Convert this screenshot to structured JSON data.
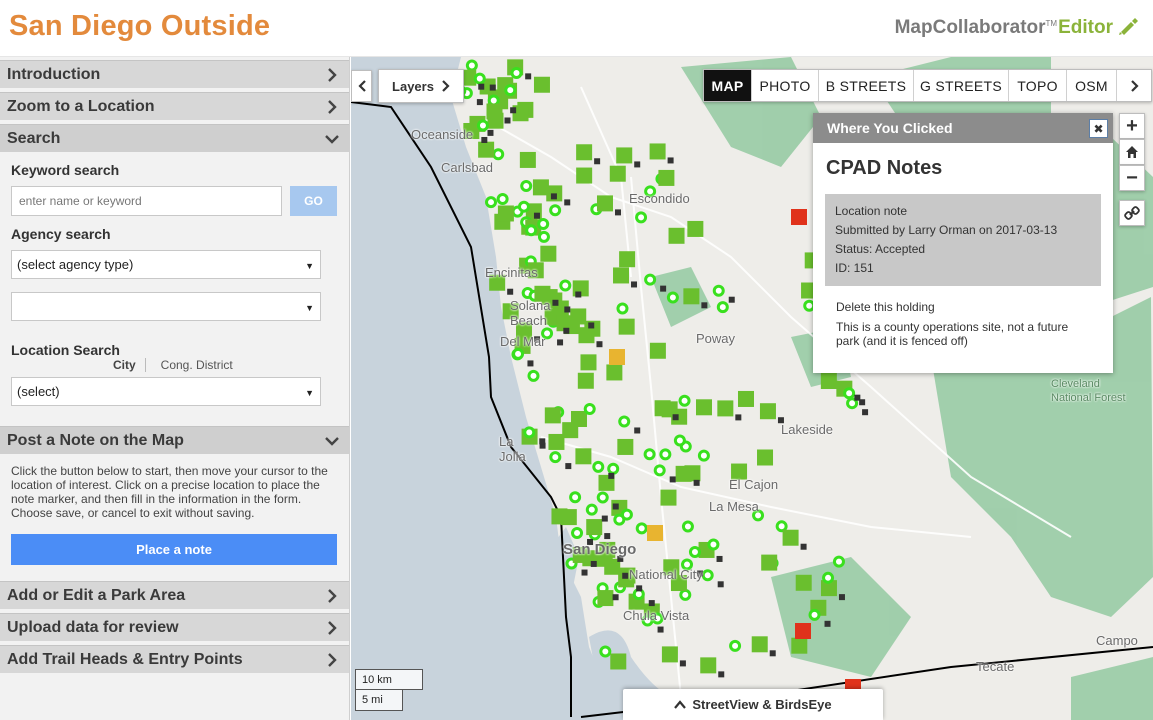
{
  "header": {
    "title": "San Diego Outside",
    "brand_name": "MapCollaborator",
    "brand_tm": "TM",
    "brand_suffix": "Editor"
  },
  "sidebar": {
    "sections": [
      {
        "label": "Introduction",
        "state": "collapsed"
      },
      {
        "label": "Zoom to a Location",
        "state": "collapsed"
      },
      {
        "label": "Search",
        "state": "expanded"
      },
      {
        "label": "Post a Note on the Map",
        "state": "expanded"
      },
      {
        "label": "Add or Edit a Park Area",
        "state": "collapsed"
      },
      {
        "label": "Upload data for review",
        "state": "collapsed"
      },
      {
        "label": "Add Trail Heads & Entry Points",
        "state": "collapsed"
      }
    ],
    "search": {
      "keyword_label": "Keyword search",
      "keyword_placeholder": "enter name or keyword",
      "go_label": "GO",
      "agency_label": "Agency search",
      "agency_selected": "(select agency type)",
      "agency_second_selected": "",
      "location_label": "Location Search",
      "location_toggle": [
        "City",
        "Cong. District"
      ],
      "location_selected": "(select)"
    },
    "post_note": {
      "instructions": "Click the button below to start, then move your cursor to the location of interest. Click on a precise location to place the note marker, and then fill in the information in the form. Choose save, or cancel to exit without saving.",
      "button_label": "Place a note"
    }
  },
  "map": {
    "layers_label": "Layers",
    "basemaps": [
      "MAP",
      "PHOTO",
      "B STREETS",
      "G STREETS",
      "TOPO",
      "OSM"
    ],
    "active_basemap": "MAP",
    "zoom_in": "+",
    "zoom_out": "−",
    "places": [
      "Oceanside",
      "Carlsbad",
      "Escondido",
      "Encinitas",
      "Solana Beach",
      "Del Mar",
      "Poway",
      "La Jolla",
      "Lakeside",
      "El Cajon",
      "La Mesa",
      "San Diego",
      "National City",
      "Chula Vista",
      "Tecate",
      "Campo",
      "Cleveland National Forest"
    ],
    "scale_km": "10 km",
    "scale_mi": "5 mi",
    "streetview_label": "StreetView & BirdsEye",
    "colors": {
      "park_green": "#8fc79c",
      "marker_green": "#6abf2e",
      "note_red": "#e0321b",
      "note_yellow": "#e8b430"
    }
  },
  "popup": {
    "header": "Where You Clicked",
    "title": "CPAD Notes",
    "note_type": "Location note",
    "submitted": "Submitted by Larry Orman on 2017-03-13",
    "status": "Status: Accepted",
    "id": "ID: 151",
    "action": "Delete this holding",
    "comment": "This is a county operations site, not a future park (and it is fenced off)"
  }
}
